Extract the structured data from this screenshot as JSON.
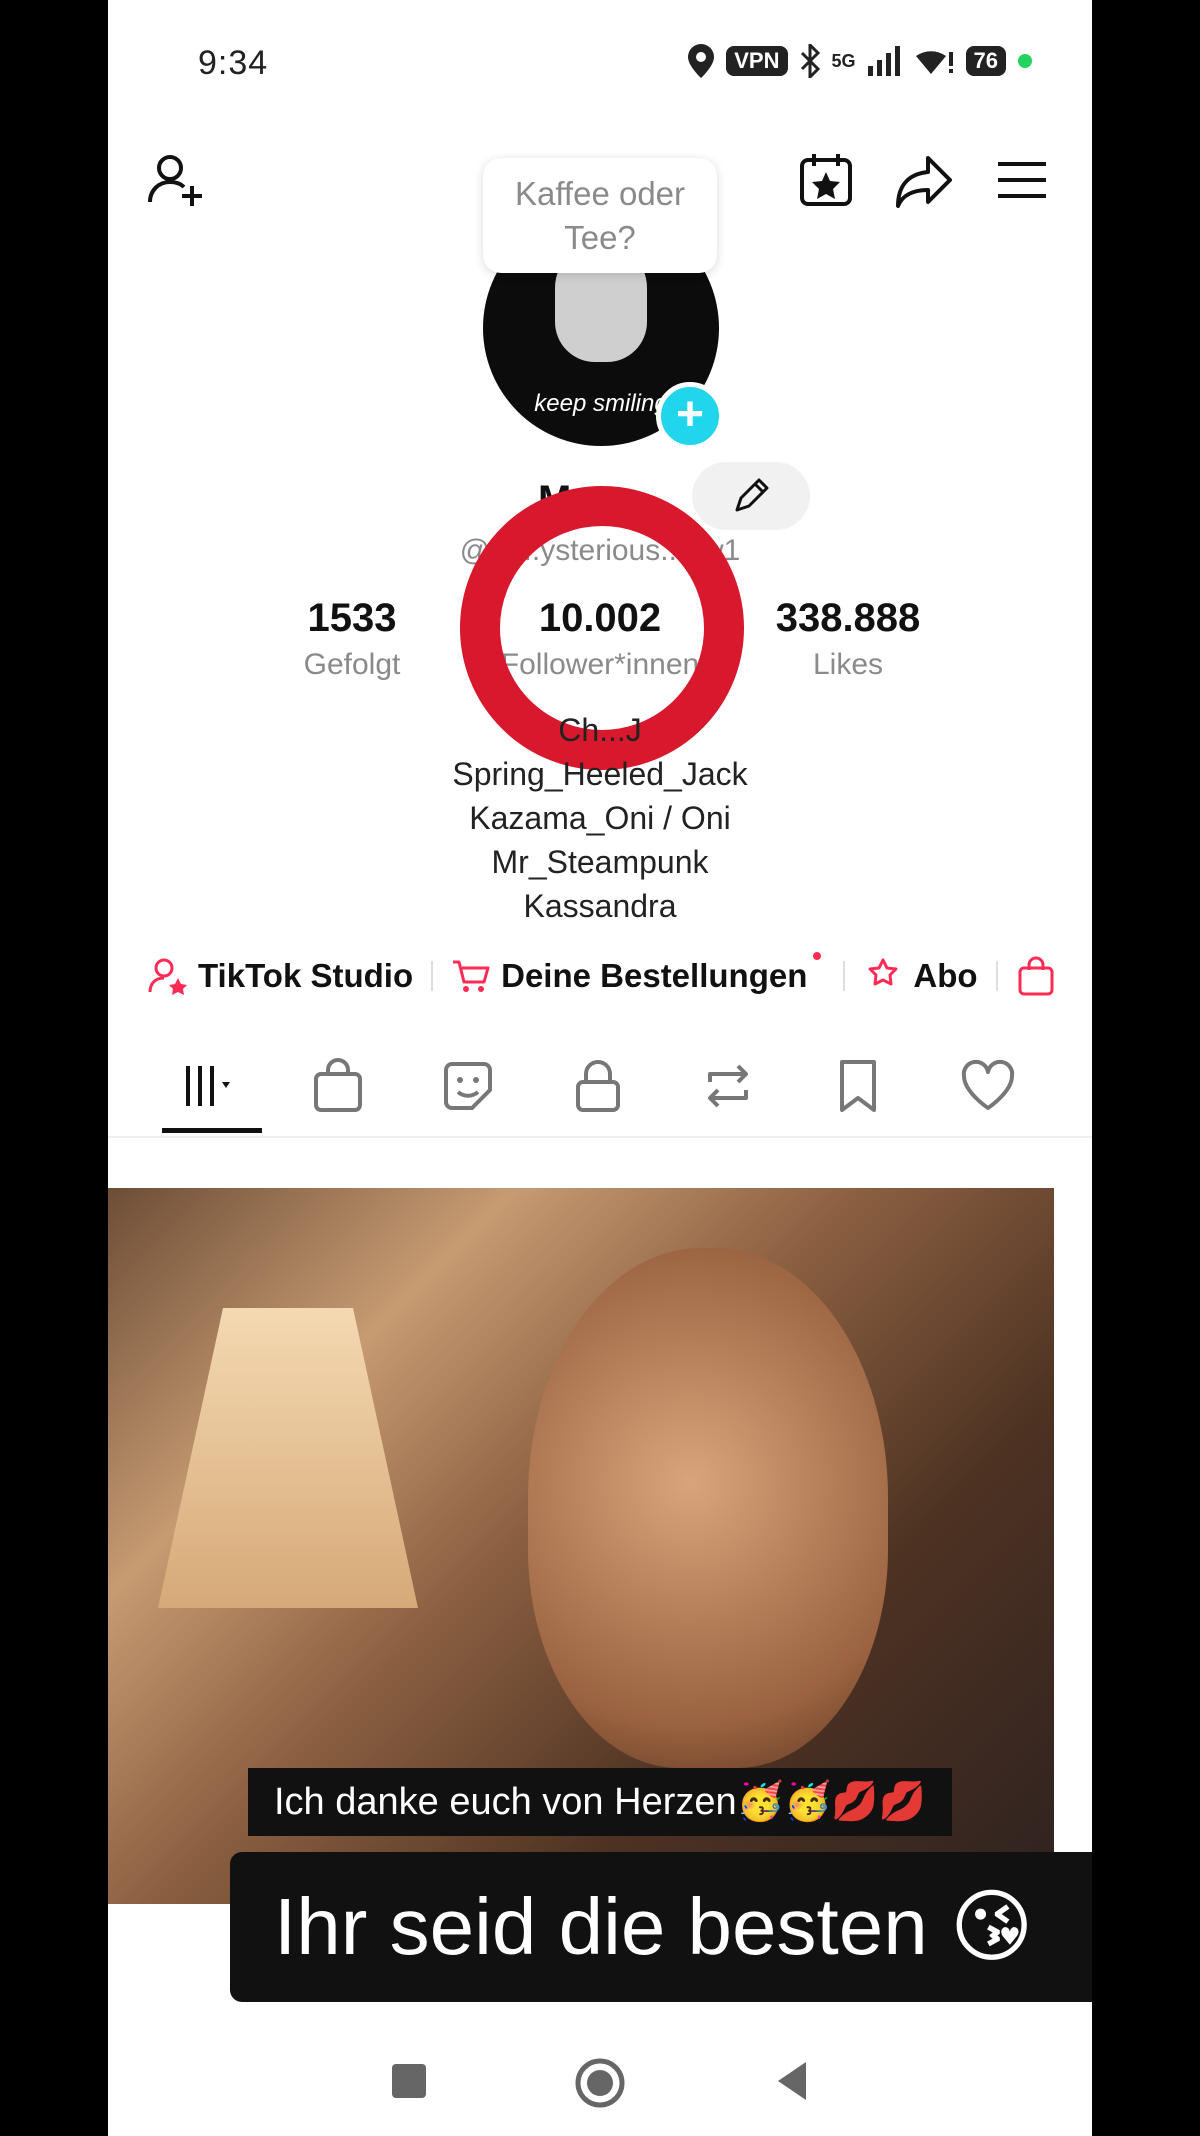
{
  "status_bar": {
    "time": "9:34",
    "vpn": "VPN",
    "network": "5G",
    "battery": "76"
  },
  "topbar": {
    "add_friend_icon": "person-plus-icon",
    "calendar_icon": "calendar-star-icon",
    "share_icon": "share-icon",
    "menu_icon": "hamburger-menu-icon"
  },
  "profile": {
    "bubble_text": "Kaffee oder Tee?",
    "avatar_caption": "keep smiling",
    "name": "M...",
    "handle": "@th...ysterious...ow1",
    "stats": [
      {
        "value": "1533",
        "label": "Gefolgt"
      },
      {
        "value": "10.002",
        "label": "Follower*innen"
      },
      {
        "value": "338.888",
        "label": "Likes"
      }
    ],
    "bio": [
      "Ch...J",
      "Spring_Heeled_Jack",
      "Kazama_Oni / Oni",
      "Mr_Steampunk",
      "Kassandra"
    ]
  },
  "shortcuts": [
    {
      "label": "TikTok Studio",
      "icon": "person-star-icon"
    },
    {
      "label": "Deine Bestellungen",
      "icon": "cart-icon"
    },
    {
      "label": "Abo",
      "icon": "star-hands-icon"
    }
  ],
  "tabs": [
    "grid-icon",
    "bag-icon",
    "sticker-icon",
    "lock-icon",
    "repost-icon",
    "bookmark-icon",
    "heart-icon"
  ],
  "overlay": {
    "caption_top": "Ich danke euch von Herzen🥳🥳💋💋",
    "caption_bottom": "Ihr seid die besten 😘"
  },
  "colors": {
    "accent": "#fe2c55",
    "ring": "#d8182c",
    "plus": "#20d5ec"
  }
}
